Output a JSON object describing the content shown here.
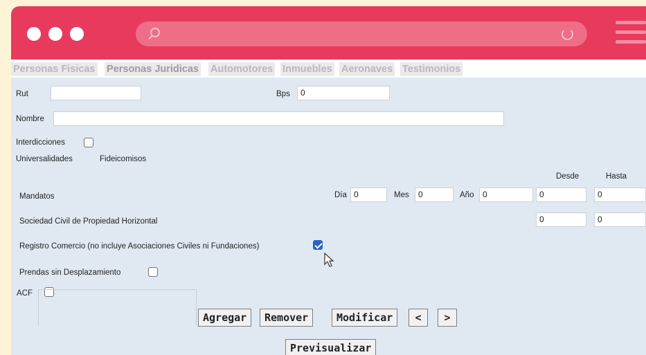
{
  "colors": {
    "topbar": "#e83a5d",
    "panel": "#e0e9f2",
    "checkbox_checked": "#2962c8"
  },
  "browser": {
    "dots": [
      "window-dot",
      "window-dot",
      "window-dot"
    ],
    "search_icon": "search-icon",
    "reload_icon": "reload-icon",
    "menu_icon": "hamburger-menu-icon"
  },
  "tabs": [
    {
      "label": "Personas Fisicas"
    },
    {
      "label": "Personas Juridicas"
    },
    {
      "label": "Automotores"
    },
    {
      "label": "Inmuebles"
    },
    {
      "label": "Aeronaves"
    },
    {
      "label": "Testimonios"
    }
  ],
  "form": {
    "rut": {
      "label": "Rut",
      "value": ""
    },
    "bps": {
      "label": "Bps",
      "value": "0"
    },
    "nombre": {
      "label": "Nombre",
      "value": ""
    },
    "interdicciones": {
      "label": "Interdicciones",
      "checked": false
    },
    "universalidades_label": "Universalidades",
    "fideicomisos_label": "Fideicomisos",
    "desde_label": "Desde",
    "hasta_label": "Hasta",
    "mandatos": {
      "label": "Mandatos",
      "dia_label": "Día",
      "dia_value": "0",
      "mes_label": "Mes",
      "mes_value": "0",
      "anio_label": "Año",
      "anio_value": "0",
      "desde_value": "0",
      "hasta_value": "0"
    },
    "sociedad": {
      "label": "Sociedad Civil de Propiedad Horizontal",
      "desde_value": "0",
      "hasta_value": "0"
    },
    "registro": {
      "label": "Registro Comercio (no incluye Asociaciones Civiles ni Fundaciones)",
      "checked": true
    },
    "prendas": {
      "label": "Prendas sin Desplazamiento",
      "checked": false
    },
    "acf": {
      "label": "ACF",
      "checked": false
    }
  },
  "buttons": {
    "agregar": "Agregar",
    "remover": "Remover",
    "modificar": "Modificar",
    "prev": "<",
    "next": ">",
    "previsualizar": "Previsualizar"
  }
}
